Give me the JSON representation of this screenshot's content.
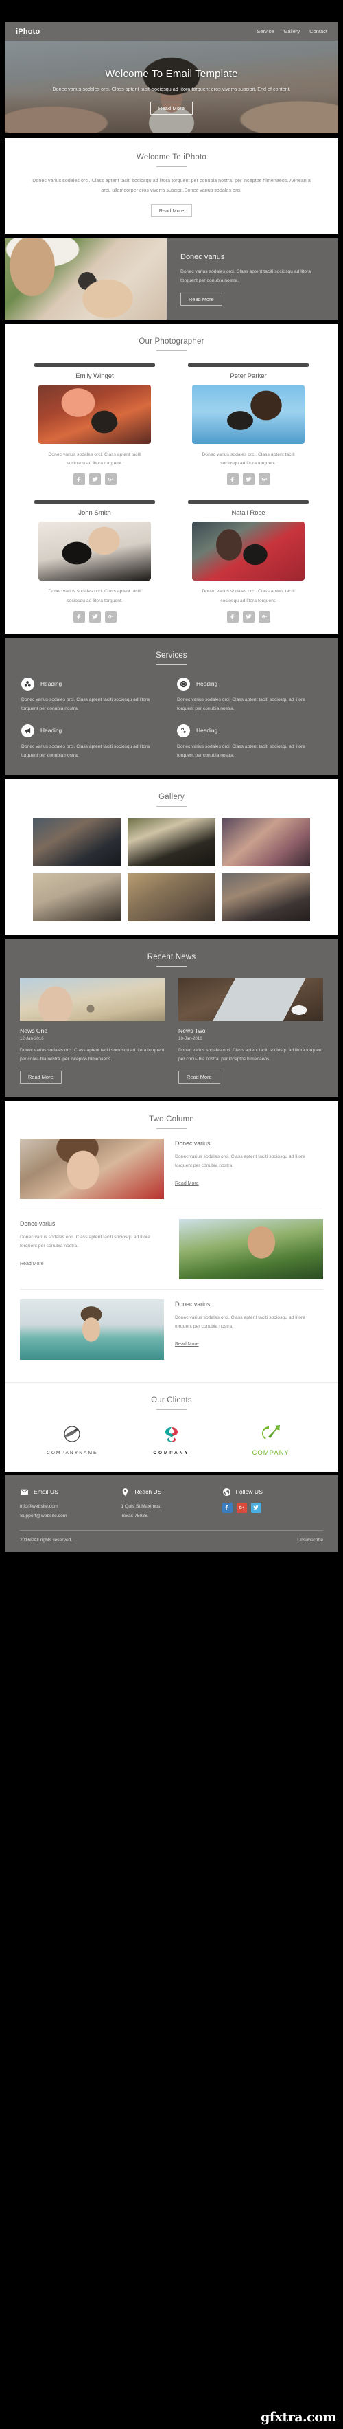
{
  "header": {
    "brand": "iPhoto",
    "nav": [
      "Service",
      "Gallery",
      "Contact"
    ]
  },
  "hero": {
    "title": "Welcome To Email Template",
    "text": "Donec varius sodales orci. Class aptent taciti sociosqu ad litora torquent eros viverra suscipit. End of content.",
    "button": "Read More"
  },
  "welcome": {
    "title": "Welcome To iPhoto",
    "text": "Donec varius sodales orci. Class aptent taciti sociosqu ad litora torquent per conubia nostra. per inceptos himenaeos. Aenean a arcu ullamcorper eros viverra suscipit.Donec varius sodales orci.",
    "button": "Read More"
  },
  "banner": {
    "title": "Donec varius",
    "text": "Donec varius sodales orci. Class aptent taciti sociosqu ad litora torquent per conubia nostra.",
    "button": "Read More"
  },
  "photographers": {
    "title": "Our Photographer",
    "desc": "Donec varius sodales orci. Class aptent taciti sociosqu ad litora torquent.",
    "items": [
      {
        "name": "Emily Winget"
      },
      {
        "name": "Peter Parker"
      },
      {
        "name": "John Smith"
      },
      {
        "name": "Natali Rose"
      }
    ],
    "socials": [
      "facebook-icon",
      "twitter-icon",
      "google-plus-icon"
    ]
  },
  "services": {
    "title": "Services",
    "items": [
      {
        "heading": "Heading",
        "icon": "cubes-icon",
        "text": "Donec varius sodales orci. Class aptent taciti sociosqu ad litora torquent per conubia nostra."
      },
      {
        "heading": "Heading",
        "icon": "life-ring-icon",
        "text": "Donec varius sodales orci. Class aptent taciti sociosqu ad litora torquent per conubia nostra."
      },
      {
        "heading": "Heading",
        "icon": "bullhorn-icon",
        "text": "Donec varius sodales orci. Class aptent taciti sociosqu ad litora torquent per conubia nostra."
      },
      {
        "heading": "Heading",
        "icon": "cogs-icon",
        "text": "Donec varius sodales orci. Class aptent taciti sociosqu ad litora torquent per conubia nostra."
      }
    ]
  },
  "gallery": {
    "title": "Gallery",
    "items": [
      "photo-1",
      "photo-2",
      "photo-3",
      "photo-4",
      "photo-5",
      "photo-6"
    ]
  },
  "news": {
    "title": "Recent News",
    "items": [
      {
        "title": "News One",
        "date": "12-Jan-2016",
        "text": "Donec varius sodales orci. Class aptent taciti sociosqu ad litora torquent per conu- bia nostra. per inceptos himenaeos.",
        "button": "Read More"
      },
      {
        "title": "News Two",
        "date": "18-Jan-2016",
        "text": "Donec varius sodales orci. Class aptent taciti sociosqu ad litora torquent per conu- bia nostra. per inceptos himenaeos.",
        "button": "Read More"
      }
    ]
  },
  "twocolumn": {
    "title": "Two Column",
    "rows": [
      {
        "title": "Donec varius",
        "text": "Donec varius sodales orci. Class aptent taciti sociosqu ad litora torquent per conubia nostra.",
        "link": "Read More"
      },
      {
        "title": "Donec varius",
        "text": "Donec varius sodales orci. Class aptent taciti sociosqu ad litora torquent per conubia nostra.",
        "link": "Read More"
      },
      {
        "title": "Donec varius",
        "text": "Donec varius sodales orci. Class aptent taciti sociosqu ad litora torquent per conubia nostra.",
        "link": "Read More"
      }
    ]
  },
  "clients": {
    "title": "Our Clients",
    "items": [
      {
        "name": "COMPANYNAME",
        "color": "#4a4a4a"
      },
      {
        "name": "COMPANY",
        "color": "#1e1e1e"
      },
      {
        "name": "COMPANY",
        "color": "#74b82f"
      }
    ]
  },
  "footer": {
    "email": {
      "heading": "Email US",
      "icon": "envelope-icon",
      "line1": "info@website.com",
      "line2": "Support@website.com"
    },
    "reach": {
      "heading": "Reach US",
      "icon": "map-marker-icon",
      "line1": "1 Quis St.Maximus.",
      "line2": "Texas 75028."
    },
    "follow": {
      "heading": "Follow US",
      "icon": "globe-icon",
      "socials": [
        {
          "name": "facebook-icon",
          "color": "#3b7dbf"
        },
        {
          "name": "google-plus-icon",
          "color": "#d9493c"
        },
        {
          "name": "twitter-icon",
          "color": "#4aaee0"
        }
      ]
    },
    "copyright": "2016©All rights reserved.",
    "unsubscribe": "Unsubscribe"
  },
  "watermark": {
    "text": "gfxtra.com"
  }
}
